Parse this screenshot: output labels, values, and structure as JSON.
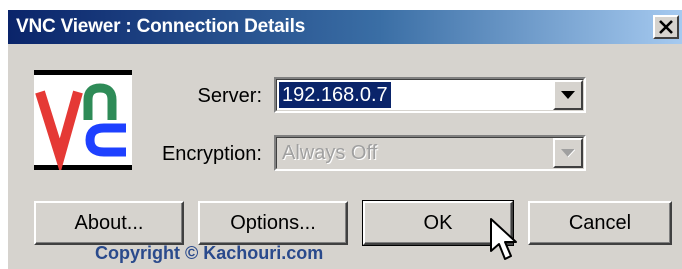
{
  "window": {
    "title": "VNC Viewer : Connection Details",
    "close_glyph": "X"
  },
  "logo": {
    "name": "vnc-logo-icon",
    "letters": [
      "V",
      "n",
      "c"
    ],
    "colors": {
      "v": "#e53935",
      "n": "#2e8b57",
      "c": "#1e40ff"
    }
  },
  "form": {
    "server": {
      "label": "Server:",
      "value": "192.168.0.7",
      "selected": true
    },
    "encryption": {
      "label": "Encryption:",
      "value": "Always Off",
      "disabled": true
    }
  },
  "buttons": {
    "about": "About...",
    "options": "Options...",
    "ok": "OK",
    "cancel": "Cancel"
  },
  "watermark": "Copyright © Kachouri.com",
  "colors": {
    "window_bg": "#d6d3ce",
    "title_start": "#0a246a",
    "title_end": "#a6caf0",
    "selection": "#0a246a"
  }
}
